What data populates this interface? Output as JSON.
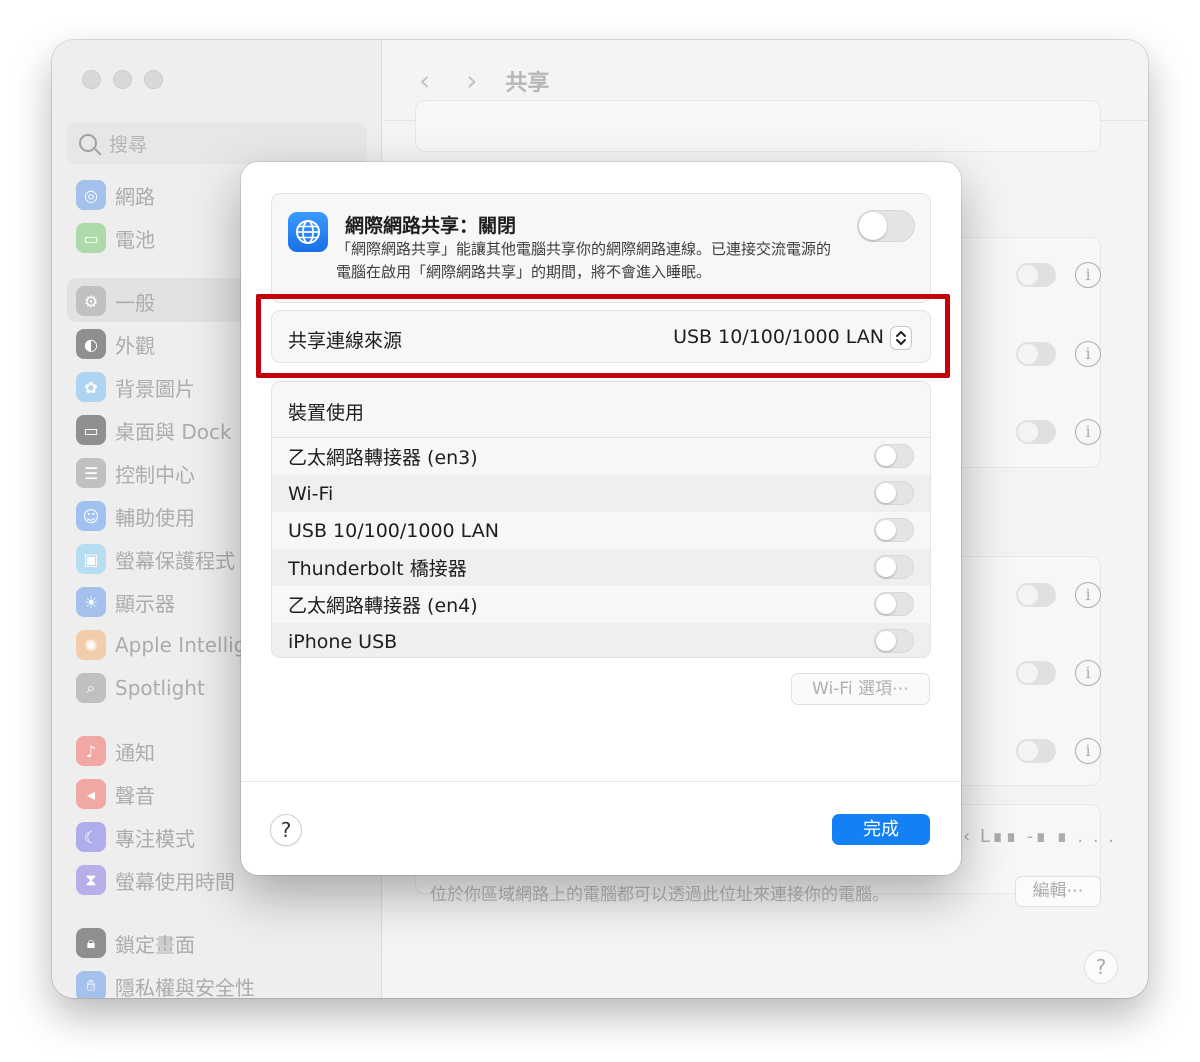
{
  "sidebar": {
    "search_placeholder": "搜尋",
    "items": [
      {
        "label": "網路",
        "icon": "globe-icon",
        "color": "#4f8fe6"
      },
      {
        "label": "電池",
        "icon": "battery-icon",
        "color": "#62c35e"
      },
      {
        "label": "一般",
        "icon": "gear-icon",
        "color": "#9a9a9a"
      },
      {
        "label": "外觀",
        "icon": "appearance-icon",
        "color": "#2b2b2b"
      },
      {
        "label": "背景圖片",
        "icon": "flower-icon",
        "color": "#5aa9e8"
      },
      {
        "label": "桌面與 Dock",
        "icon": "dock-icon",
        "color": "#2b2b2b"
      },
      {
        "label": "控制中心",
        "icon": "switches-icon",
        "color": "#9a9a9a"
      },
      {
        "label": "輔助使用",
        "icon": "accessibility-icon",
        "color": "#3d86e6"
      },
      {
        "label": "螢幕保護程式",
        "icon": "screensaver-icon",
        "color": "#68bde5"
      },
      {
        "label": "顯示器",
        "icon": "sun-icon",
        "color": "#4f8fe6"
      },
      {
        "label": "Apple Intelligence",
        "icon": "apple-intelligence-icon",
        "color": "#e9a35b"
      },
      {
        "label": "Spotlight",
        "icon": "magnifier-icon",
        "color": "#9a9a9a"
      },
      {
        "label": "通知",
        "icon": "bell-icon",
        "color": "#e7554f"
      },
      {
        "label": "聲音",
        "icon": "speaker-icon",
        "color": "#e7554f"
      },
      {
        "label": "專注模式",
        "icon": "moon-icon",
        "color": "#5d5ad6"
      },
      {
        "label": "螢幕使用時間",
        "icon": "hourglass-icon",
        "color": "#6a5ad6"
      },
      {
        "label": "鎖定畫面",
        "icon": "lock-icon",
        "color": "#2b2b2b"
      },
      {
        "label": "隱私權與安全性",
        "icon": "hand-icon",
        "color": "#4f8fe6"
      }
    ]
  },
  "nav": {
    "title": "共享"
  },
  "background": {
    "note": "位於你區域網路上的電腦都可以透過此位址來連接你的電腦。",
    "edit_label": "編輯⋯",
    "help_label": "?",
    "blurred_text": "‹ L∎∎ -∎ ∎ . . ."
  },
  "sheet": {
    "internet_sharing": {
      "title": "網際網路共享：關閉",
      "description": "「網際網路共享」能讓其他電腦共享你的網際網路連線。已連接交流電源的電腦在啟用「網際網路共享」的期間，將不會進入睡眠。",
      "enabled": false
    },
    "source": {
      "label": "共享連線來源",
      "value": "USB 10/100/1000 LAN"
    },
    "devices_header": "裝置使用",
    "devices": [
      {
        "name": "乙太網路轉接器 (en3)",
        "enabled": false
      },
      {
        "name": "Wi-Fi",
        "enabled": false
      },
      {
        "name": "USB 10/100/1000 LAN",
        "enabled": false
      },
      {
        "name": "Thunderbolt 橋接器",
        "enabled": false
      },
      {
        "name": "乙太網路轉接器 (en4)",
        "enabled": false
      },
      {
        "name": "iPhone USB",
        "enabled": false
      }
    ],
    "wifi_options_label": "Wi-Fi 選項⋯",
    "help_label": "?",
    "done_label": "完成"
  },
  "colors": {
    "accent": "#1380f5",
    "highlight": "#c6000b"
  }
}
